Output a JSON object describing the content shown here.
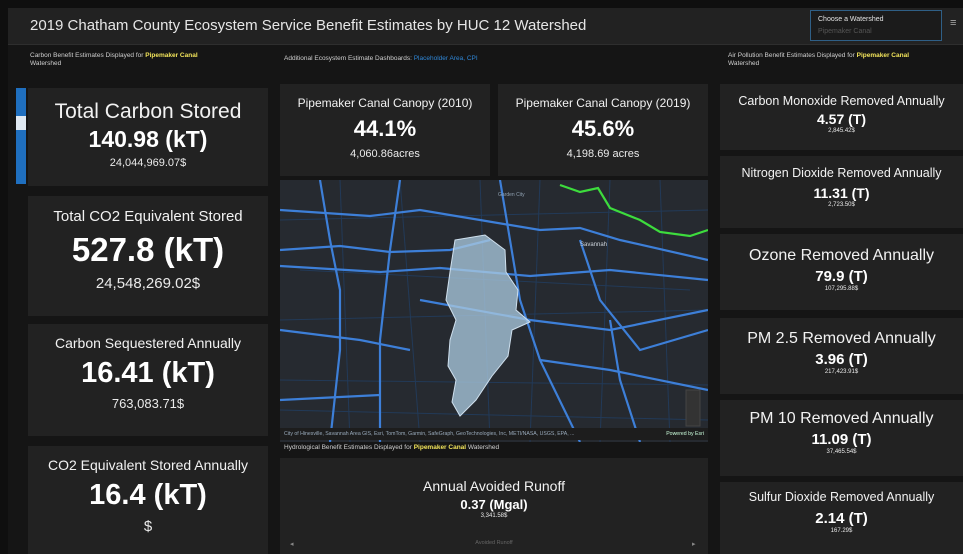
{
  "header": {
    "title": "2019 Chatham County Ecosystem Service Benefit Estimates by HUC 12 Watershed"
  },
  "selector": {
    "label": "Choose a Watershed",
    "placeholder": "Pipemaker Canal"
  },
  "left": {
    "heading_prefix": "Carbon Benefit Estimates Displayed for ",
    "heading_highlight": "Pipemaker Canal",
    "heading_suffix": "Watershed",
    "cards": [
      {
        "title": "Total Carbon Stored",
        "value": "140.98 (kT)",
        "sub": "24,044,969.07$"
      },
      {
        "title": "Total CO2 Equivalent Stored",
        "value": "527.8 (kT)",
        "sub": "24,548,269.02$"
      },
      {
        "title": "Carbon Sequestered Annually",
        "value": "16.41 (kT)",
        "sub": "763,083.71$"
      },
      {
        "title": "CO2 Equivalent Stored Annually",
        "value": "16.4 (kT)",
        "sub": "$"
      }
    ]
  },
  "middle": {
    "heading_prefix": "Additional Ecosystem Estimate Dashboards: ",
    "heading_links": "Placeholder Area, CPI",
    "canopy": [
      {
        "title": "Pipemaker Canal Canopy (2010)",
        "value": "44.1%",
        "sub": "4,060.86acres"
      },
      {
        "title": "Pipemaker Canal Canopy (2019)",
        "value": "45.6%",
        "sub": "4,198.69 acres"
      }
    ],
    "map": {
      "labels": [
        "Savannah",
        "Garden City"
      ],
      "attribution": "City of Hinesville, Savannah Area GIS, Esri, TomTom, Garmin, SafeGraph, GeoTechnologies, Inc, METI/NASA, USGS, EPA, ...",
      "powered": "Powered by Esri"
    },
    "hydro_prefix": "Hydrological Benefit Estimates Displayed for ",
    "hydro_highlight": "Pipemaker Canal",
    "hydro_suffix": " Watershed",
    "runoff": {
      "title": "Annual Avoided Runoff",
      "value": "0.37 (Mgal)",
      "sub": "3,341.58$",
      "footer": "Avoided Runoff"
    }
  },
  "right": {
    "heading_prefix": "Air Pollution Benefit Estimates Displayed for ",
    "heading_highlight": "Pipemaker Canal",
    "heading_suffix": "Watershed",
    "cards": [
      {
        "title": "Carbon Monoxide Removed Annually",
        "value": "4.57 (T)",
        "sub": "2,845.42$"
      },
      {
        "title": "Nitrogen Dioxide Removed Annually",
        "value": "11.31 (T)",
        "sub": "2,723.50$"
      },
      {
        "title": "Ozone Removed Annually",
        "value": "79.9 (T)",
        "sub": "107,295.88$"
      },
      {
        "title": "PM 2.5 Removed Annually",
        "value": "3.96 (T)",
        "sub": "217,423.91$"
      },
      {
        "title": "PM 10 Removed Annually",
        "value": "11.09 (T)",
        "sub": "37,465.54$"
      },
      {
        "title": "Sulfur Dioxide Removed Annually",
        "value": "2.14 (T)",
        "sub": "167.29$"
      }
    ]
  },
  "colors": {
    "highlight": "#f1e35a",
    "link": "#2f86d6",
    "card": "#222222",
    "watershed": "#a8c6dd",
    "road": "#3d7fd8",
    "river": "#3ddc3d"
  }
}
